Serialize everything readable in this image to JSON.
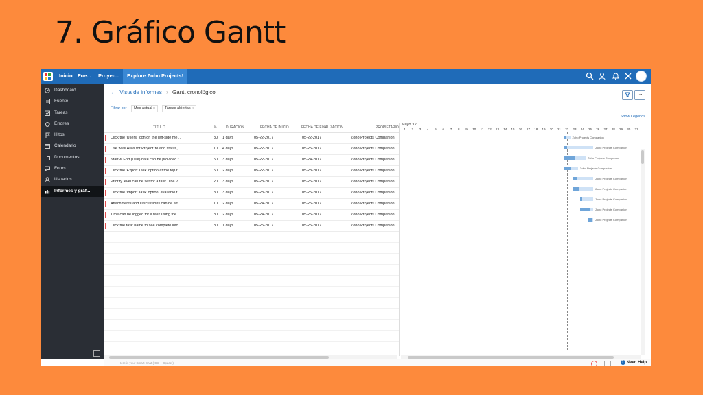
{
  "slide_title": "7. Gráfico Gantt",
  "topbar": {
    "nav": [
      "Inicio",
      "Fue...",
      "Proyec..."
    ],
    "active_tab": "Explore Zoho Projects!",
    "icons": [
      "search-icon",
      "user-switch-icon",
      "bell-icon",
      "tools-icon",
      "avatar"
    ],
    "color": "#1f6bb8"
  },
  "sidebar": {
    "items": [
      {
        "label": "Dashboard",
        "icon": "dashboard-icon"
      },
      {
        "label": "Fuente",
        "icon": "feed-icon"
      },
      {
        "label": "Tareas",
        "icon": "tasks-icon"
      },
      {
        "label": "Errores",
        "icon": "bug-icon"
      },
      {
        "label": "Hitos",
        "icon": "milestone-icon"
      },
      {
        "label": "Calendario",
        "icon": "calendar-icon"
      },
      {
        "label": "Documentos",
        "icon": "documents-icon"
      },
      {
        "label": "Foros",
        "icon": "forums-icon"
      },
      {
        "label": "Usuarios",
        "icon": "users-icon"
      },
      {
        "label": "Informes y gráf...",
        "icon": "reports-icon"
      }
    ],
    "active_index": 9
  },
  "breadcrumb": {
    "parent": "Vista de informes",
    "current": "Gantt cronológico"
  },
  "filters": {
    "label": "Filtrar por",
    "chips": [
      "Mes actual",
      "Tareas abiertas"
    ],
    "chip_close": "x"
  },
  "show_legends": "Show Legends",
  "table": {
    "columns": [
      "TÍTULO",
      "%",
      "DURACIÓN",
      "FECHA DE INICIO",
      "FECHA DE FINALIZACIÓN",
      "PROPIETARIO"
    ],
    "rows": [
      {
        "title": "Click the 'Users' icon on the left-side me...",
        "pct": "30",
        "duration": "1 days",
        "start": "05-22-2017",
        "end": "05-22-2017",
        "owner": "Zoho Projects Companion"
      },
      {
        "title": "Use 'Mail Alias for Project' to add status, ...",
        "pct": "10",
        "duration": "4 days",
        "start": "05-22-2017",
        "end": "05-25-2017",
        "owner": "Zoho Projects Companion"
      },
      {
        "title": "Start & End (Due) date can be provided f...",
        "pct": "50",
        "duration": "3 days",
        "start": "05-22-2017",
        "end": "05-24-2017",
        "owner": "Zoho Projects Companion"
      },
      {
        "title": "Click the 'Export Task' option at the top r...",
        "pct": "50",
        "duration": "2 days",
        "start": "05-22-2017",
        "end": "05-23-2017",
        "owner": "Zoho Projects Companion"
      },
      {
        "title": "Priority level can be set for a task. The v...",
        "pct": "20",
        "duration": "3 days",
        "start": "05-23-2017",
        "end": "05-25-2017",
        "owner": "Zoho Projects Companion"
      },
      {
        "title": "Click the 'Import Task' option, available t...",
        "pct": "30",
        "duration": "3 days",
        "start": "05-23-2017",
        "end": "05-25-2017",
        "owner": "Zoho Projects Companion"
      },
      {
        "title": "Attachments and Discussions can be att...",
        "pct": "10",
        "duration": "2 days",
        "start": "05-24-2017",
        "end": "05-25-2017",
        "owner": "Zoho Projects Companion"
      },
      {
        "title": "Time can be logged for a task using the ...",
        "pct": "80",
        "duration": "2 days",
        "start": "05-24-2017",
        "end": "05-25-2017",
        "owner": "Zoho Projects Companion"
      },
      {
        "title": "Click the task name to see complete info...",
        "pct": "80",
        "duration": "1 days",
        "start": "05-25-2017",
        "end": "05-25-2017",
        "owner": "Zoho Projects Companion"
      }
    ]
  },
  "gantt": {
    "month_label": "Mayo '17",
    "days": [
      1,
      2,
      3,
      4,
      5,
      6,
      7,
      8,
      9,
      10,
      11,
      12,
      13,
      14,
      15,
      16,
      17,
      18,
      19,
      20,
      21,
      22,
      23,
      24,
      25,
      26,
      27,
      28,
      29,
      30,
      31
    ],
    "today_day": 22,
    "bar_label": "Zoho Projects Companion",
    "colors": {
      "done": "#6fa5d9",
      "planned": "#cfe2f6"
    }
  },
  "chat": {
    "placeholder": "Here is your Smart Chat ( Ctrl + Space )",
    "help": "Need Help"
  }
}
